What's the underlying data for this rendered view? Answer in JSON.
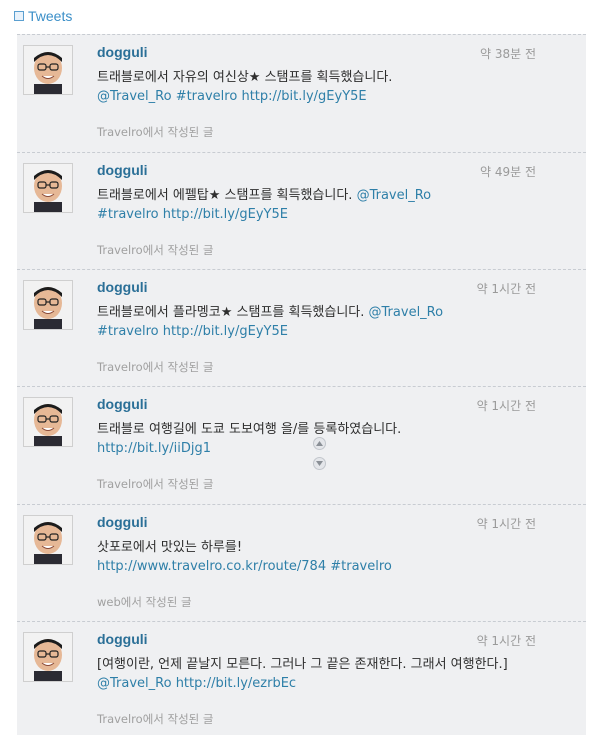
{
  "header": {
    "title": "Tweets"
  },
  "tweets": [
    {
      "username": "dogguli",
      "time": "약 38분 전",
      "text": "트래블로에서 자유의 여신상★ 스탬프를 획득했습니다.",
      "mention": "@Travel_Ro",
      "hashtag": "#travelro",
      "link": "http://bit.ly/gEyY5E",
      "source": "Travelro에서 작성된 글"
    },
    {
      "username": "dogguli",
      "time": "약 49분 전",
      "text": "트래블로에서 에펠탑★ 스탬프를 획득했습니다.",
      "mention": "@Travel_Ro",
      "hashtag": "#travelro",
      "link": "http://bit.ly/gEyY5E",
      "source": "Travelro에서 작성된 글"
    },
    {
      "username": "dogguli",
      "time": "약 1시간 전",
      "text": "트래블로에서 플라멩코★ 스탬프를 획득했습니다.",
      "mention": "@Travel_Ro",
      "hashtag": "#travelro",
      "link": "http://bit.ly/gEyY5E",
      "source": "Travelro에서 작성된 글"
    },
    {
      "username": "dogguli",
      "time": "약 1시간 전",
      "text": "트래블로 여행길에 도쿄 도보여행 을/를 등록하였습니다.",
      "link": "http://bit.ly/iiDjg1",
      "source": "Travelro에서 작성된 글"
    },
    {
      "username": "dogguli",
      "time": "약 1시간 전",
      "text": "삿포로에서 맛있는 하루를!",
      "link": "http://www.travelro.co.kr/route/784",
      "hashtag": "#travelro",
      "source": "web에서 작성된 글"
    },
    {
      "username": "dogguli",
      "time": "약 1시간 전",
      "text": "[여행이란, 언제 끝날지 모른다. 그러나 그 끝은 존재한다. 그래서 여행한다.]",
      "mention": "@Travel_Ro",
      "link": "http://bit.ly/ezrbEc",
      "source": "Travelro에서 작성된 글"
    }
  ]
}
